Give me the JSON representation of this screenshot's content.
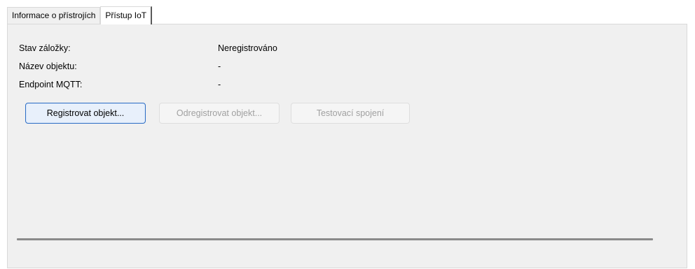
{
  "tabs": [
    {
      "label": "Informace o přístrojích",
      "active": false
    },
    {
      "label": "Přístup IoT",
      "active": true
    }
  ],
  "fields": [
    {
      "label": "Stav záložky:",
      "value": "Neregistrováno"
    },
    {
      "label": "Název objektu:",
      "value": "-"
    },
    {
      "label": "Endpoint MQTT:",
      "value": "-"
    }
  ],
  "buttons": {
    "register": {
      "label": "Registrovat objekt...",
      "enabled": true
    },
    "unregister": {
      "label": "Odregistrovat objekt...",
      "enabled": false
    },
    "test": {
      "label": "Testovací spojení",
      "enabled": false
    }
  },
  "colors": {
    "panel_bg": "#f0f0f0",
    "focus_border": "#2f6fc6",
    "disabled_text": "#a0a0a0"
  }
}
